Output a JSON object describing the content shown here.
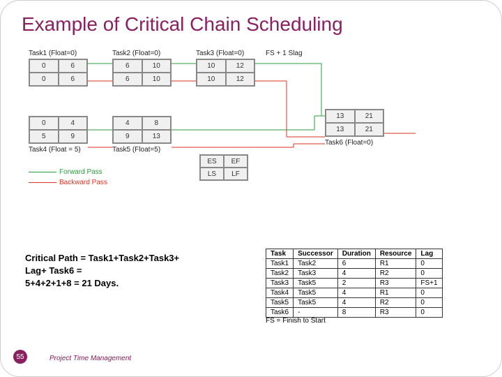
{
  "title": "Example of Critical Chain Scheduling",
  "tasks": {
    "task1": {
      "label": "Task1 (Float=0)",
      "es": "0",
      "ef": "6",
      "ls": "0",
      "lf": "6"
    },
    "task2": {
      "label": "Task2 (Float=0)",
      "es": "6",
      "ef": "10",
      "ls": "6",
      "lf": "10"
    },
    "task3": {
      "label": "Task3 (Float=0)",
      "es": "10",
      "ef": "12",
      "ls": "10",
      "lf": "12"
    },
    "task4": {
      "label": "Task4 (Float = 5)",
      "es": "0",
      "ef": "4",
      "ls": "5",
      "lf": "9"
    },
    "task5": {
      "label": "Task5 (Float=5)",
      "es": "4",
      "ef": "8",
      "ls": "9",
      "lf": "13"
    },
    "task6": {
      "label": "Task6 (Float=0)",
      "es": "13",
      "ef": "21",
      "ls": "13",
      "lf": "21"
    }
  },
  "fs_slag": "FS + 1 Slag",
  "legend": {
    "es": "ES",
    "ef": "EF",
    "ls": "LS",
    "lf": "LF",
    "forward": "Forward Pass",
    "backward": "Backward Pass"
  },
  "critical_path": {
    "line1": "Critical Path = Task1+Task2+Task3+",
    "line2": "Lag+ Task6 =",
    "line3": " 5+4+2+1+8 = 21 Days."
  },
  "summary": {
    "headers": [
      "Task",
      "Successor",
      "Duration",
      "Resource",
      "Lag"
    ],
    "rows": [
      [
        "Task1",
        "Task2",
        "6",
        "R1",
        "0"
      ],
      [
        "Task2",
        "Task3",
        "4",
        "R2",
        "0"
      ],
      [
        "Task3",
        "Task5",
        "2",
        "R3",
        "FS+1"
      ],
      [
        "Task4",
        "Task5",
        "4",
        "R1",
        "0"
      ],
      [
        "Task5",
        "Task5",
        "4",
        "R2",
        "0"
      ],
      [
        "Task6",
        "-",
        "8",
        "R3",
        "0"
      ]
    ],
    "note": "FS = Finish to Start"
  },
  "slide_number": "55",
  "footer": "Project Time Management"
}
